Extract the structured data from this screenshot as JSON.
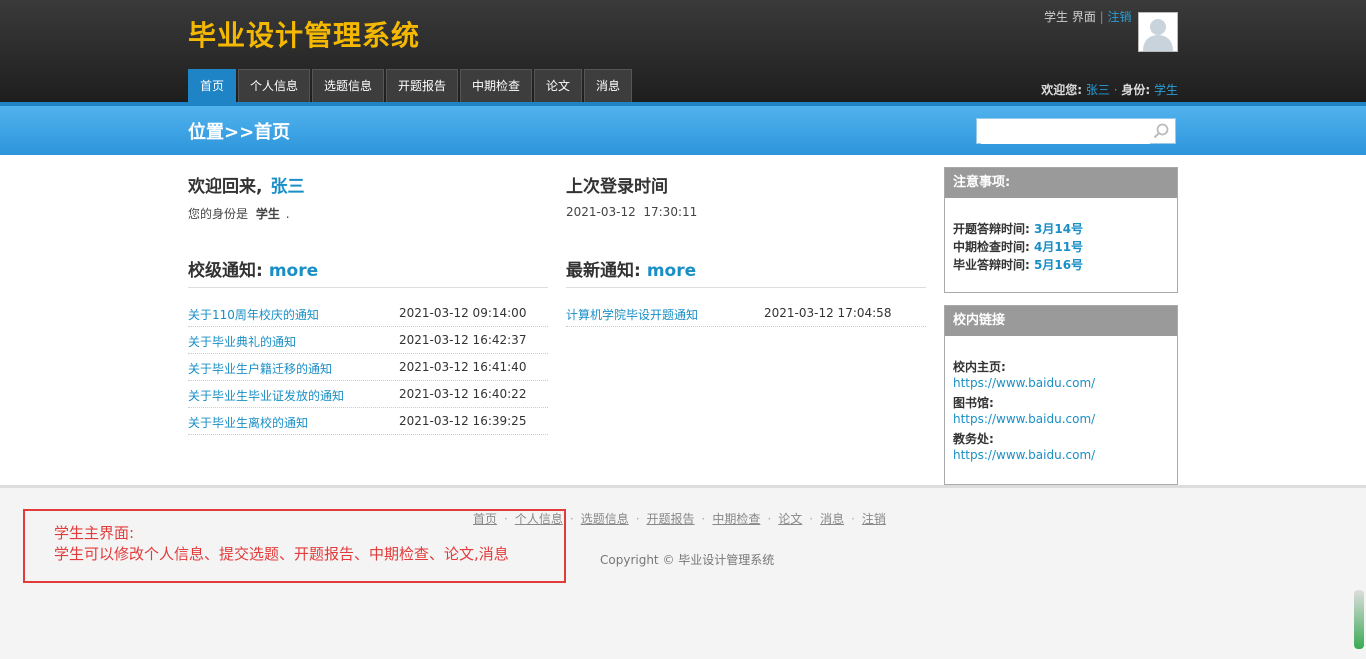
{
  "header": {
    "site_title": "毕业设计管理系统",
    "role_interface": "学生 界面",
    "logout": "注销",
    "tabs": [
      {
        "label": "首页"
      },
      {
        "label": "个人信息"
      },
      {
        "label": "选题信息"
      },
      {
        "label": "开题报告"
      },
      {
        "label": "中期检查"
      },
      {
        "label": "论文"
      },
      {
        "label": "消息"
      }
    ],
    "welcome_label": "欢迎您:",
    "user_name": "张三",
    "identity_label": "身份:",
    "identity_value": "学生"
  },
  "location": {
    "title": "位置>>首页",
    "search_placeholder": ""
  },
  "welcome": {
    "heading": "欢迎回来,",
    "name": "张三",
    "identity_text": "您的身份是",
    "identity_value": "学生",
    "identity_end": "."
  },
  "last_login": {
    "heading": "上次登录时间",
    "value": "2021-03-12  17:30:11"
  },
  "school_notices": {
    "heading": "校级通知:",
    "more": "more",
    "items": [
      {
        "title": "关于110周年校庆的通知",
        "date": "2021-03-12 09:14:00"
      },
      {
        "title": "关于毕业典礼的通知",
        "date": "2021-03-12 16:42:37"
      },
      {
        "title": "关于毕业生户籍迁移的通知",
        "date": "2021-03-12 16:41:40"
      },
      {
        "title": "关于毕业生毕业证发放的通知",
        "date": "2021-03-12 16:40:22"
      },
      {
        "title": "关于毕业生离校的通知",
        "date": "2021-03-12 16:39:25"
      }
    ]
  },
  "latest_notices": {
    "heading": "最新通知:",
    "more": "more",
    "items": [
      {
        "title": "计算机学院毕设开题通知",
        "date": "2021-03-12 17:04:58"
      }
    ]
  },
  "notice_box": {
    "title": "注意事项:",
    "items": [
      {
        "label": "开题答辩时间:",
        "value": "3月14号"
      },
      {
        "label": "中期检查时间:",
        "value": "4月11号"
      },
      {
        "label": "毕业答辩时间:",
        "value": "5月16号"
      }
    ]
  },
  "links_box": {
    "title": "校内链接",
    "items": [
      {
        "label": "校内主页:",
        "url": "https://www.baidu.com/"
      },
      {
        "label": "图书馆:",
        "url": "https://www.baidu.com/"
      },
      {
        "label": "教务处:",
        "url": "https://www.baidu.com/"
      }
    ]
  },
  "footer": {
    "links": [
      "首页",
      "个人信息",
      "选题信息",
      "开题报告",
      "中期检查",
      "论文",
      "消息",
      "注销"
    ],
    "separator": "·",
    "copyright": "Copyright © 毕业设计管理系统"
  },
  "annotation": {
    "line1": "学生主界面:",
    "line2": "学生可以修改个人信息、提交选题、开题报告、中期检查、论文,消息"
  },
  "colors": {
    "brand_yellow": "#f5b800",
    "accent_blue": "#1f84c6",
    "link_blue": "#1a8fc6",
    "annotation_red": "#e23b3b"
  }
}
